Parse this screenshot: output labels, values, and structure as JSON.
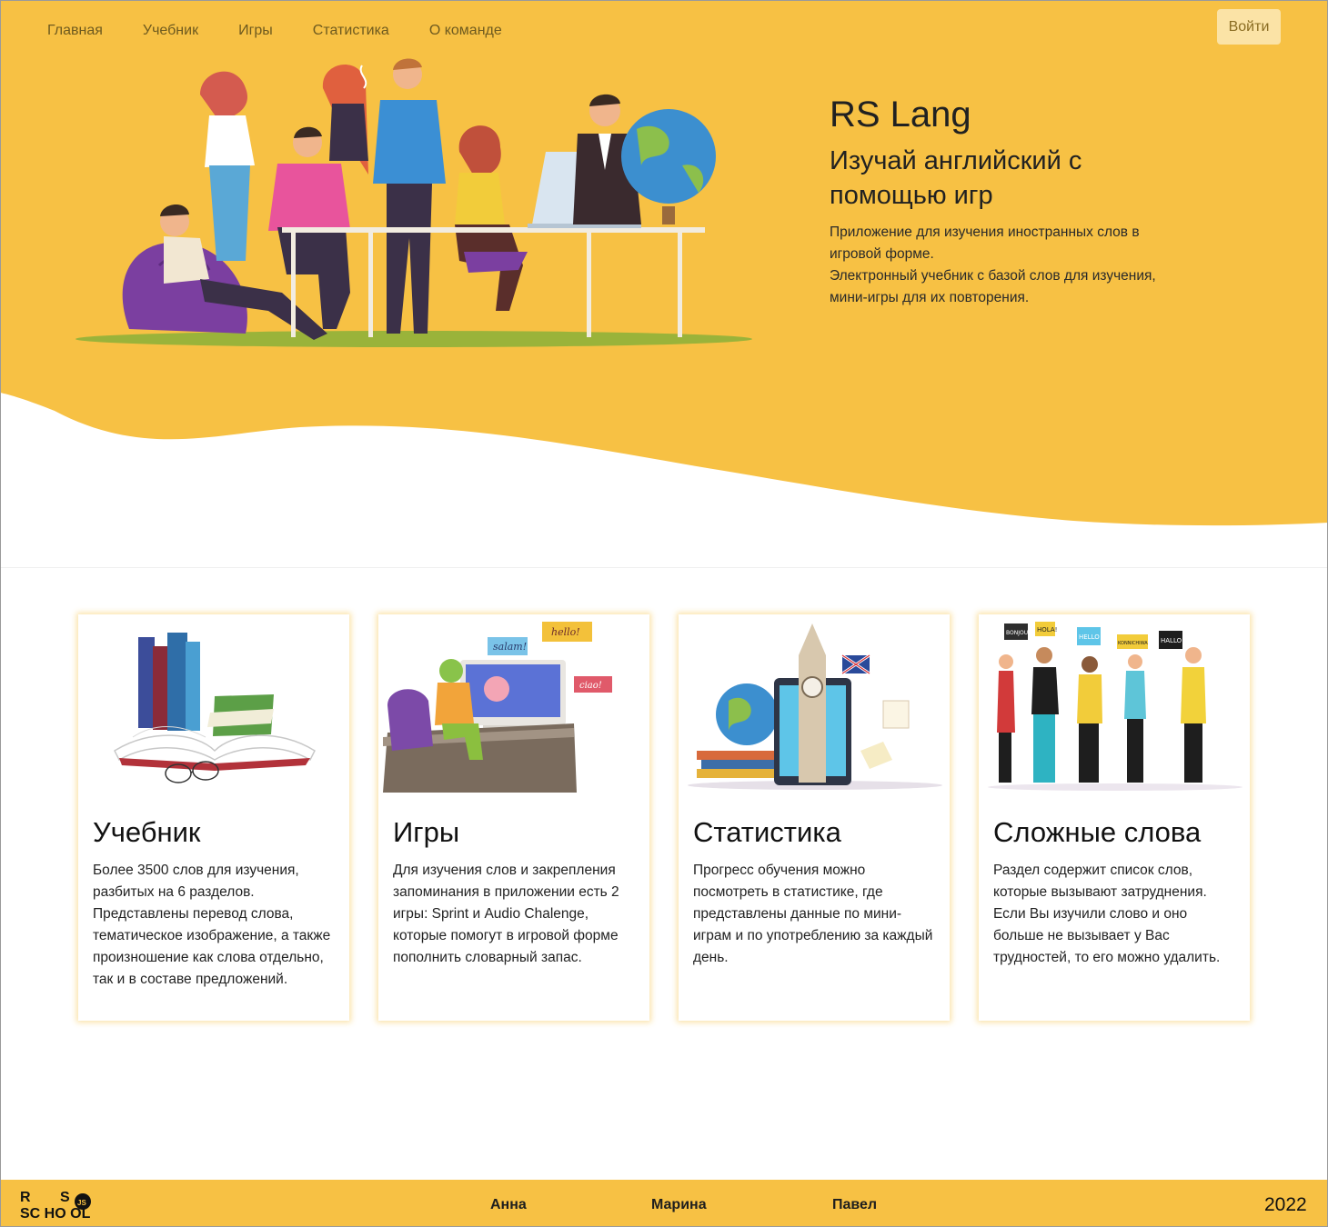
{
  "nav": {
    "items": [
      {
        "label": "Главная"
      },
      {
        "label": "Учебник"
      },
      {
        "label": "Игры"
      },
      {
        "label": "Статистика"
      },
      {
        "label": "О команде"
      }
    ],
    "login_label": "Войти"
  },
  "hero": {
    "title": "RS Lang",
    "subtitle": "Изучай английский с помощью игр",
    "description_line1": "Приложение для изучения иностранных слов в игровой форме.",
    "description_line2": "Электронный учебник с базой слов для изучения, мини-игры для их повторения."
  },
  "cards": [
    {
      "title": "Учебник",
      "text": "Более 3500 слов для изучения, разбитых на 6 разделов. Представлены перевод слова, тематическое изображение, а также произношение как слова отдельно, так и в составе предложений."
    },
    {
      "title": "Игры",
      "text": "Для изучения слов и закрепления запоминания в приложении есть 2 игры: Sprint и Audio Chalenge, которые помогут в игровой форме пополнить словарный запас.",
      "image_bubbles": [
        "salam!",
        "hello!",
        "ciao!"
      ]
    },
    {
      "title": "Статистика",
      "text": "Прогресс обучения можно посмотреть в статистике, где представлены данные по мини-играм и по употреблению за каждый день."
    },
    {
      "title": "Сложные слова",
      "text": "Раздел содержит список слов, которые вызывают затруднения. Если Вы изучили слово и оно больше не вызывает у Вас трудностей, то его можно удалить.",
      "image_bubbles": [
        "BONJOUR",
        "HOLA!",
        "HELLO",
        "KONNICHIWA",
        "HALLO"
      ]
    }
  ],
  "footer": {
    "logo_text": "RS SCHOOL JS",
    "authors": [
      "Анна",
      "Марина",
      "Павел"
    ],
    "year": "2022"
  },
  "colors": {
    "brand_yellow": "#f7c144",
    "login_bg": "#fbe3a6",
    "card_glow": "#f7c03f"
  }
}
